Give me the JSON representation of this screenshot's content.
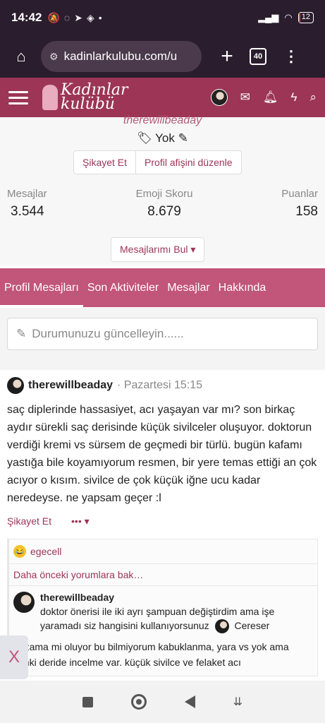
{
  "status_bar": {
    "time": "14:42",
    "battery": "12"
  },
  "browser": {
    "url": "kadinlarkulubu.com/u",
    "tab_count": "40"
  },
  "site": {
    "logo_line1": "Kadınlar",
    "logo_line2": "kulübü"
  },
  "profile": {
    "username_faded": "therewillbeaday",
    "tag_text": "Yok",
    "report_label": "Şikayet Et",
    "edit_banner_label": "Profil afişini düzenle",
    "stats": [
      {
        "label": "Mesajlar",
        "value": "3.544"
      },
      {
        "label": "Emoji Skoru",
        "value": "8.679"
      },
      {
        "label": "Puanlar",
        "value": "158"
      }
    ],
    "find_messages_label": "Mesajlarımı Bul"
  },
  "tabs": [
    "Profil Mesajları",
    "Son Aktiviteler",
    "Mesajlar",
    "Hakkında"
  ],
  "status_update": {
    "placeholder": "Durumunuzu güncelleyin......"
  },
  "post": {
    "user": "therewillbeaday",
    "time": "· Pazartesi 15:15",
    "body": "saç diplerinde hassasiyet, acı yaşayan var mı? son birkaç aydır sürekli saç derisinde küçük sivilceler oluşuyor. doktorun verdiği kremi vs sürsem de geçmedi bir türlü. bugün kafamı yastığa bile koyamıyorum resmen, bir yere temas ettiği an çok acıyor o kısım. sivilce de çok küçük iğne ucu kadar neredeyse. ne yapsam geçer :l",
    "report_label": "Şikayet Et",
    "more_label": "•••",
    "reaction_user": "egecell",
    "older_comments": "Daha önceki yorumlara bak…",
    "comment_user": "therewillbeaday",
    "comment_text": "doktor önerisi ile iki ayrı şampuan değiştirdim ama işe yaramadı siz hangisini kullanıyorsunuz",
    "reply_user": "Cereser",
    "reply_text": "egzama mi oluyor bu bilmiyorum kabuklanma, yara vs yok ama sanki deride incelme var. küçük sivilce ve felaket acı"
  },
  "overlay": {
    "close_label": "X"
  },
  "colors": {
    "brand": "#9c3556",
    "tabs": "#c1557a",
    "browser": "#2a1d2d"
  }
}
